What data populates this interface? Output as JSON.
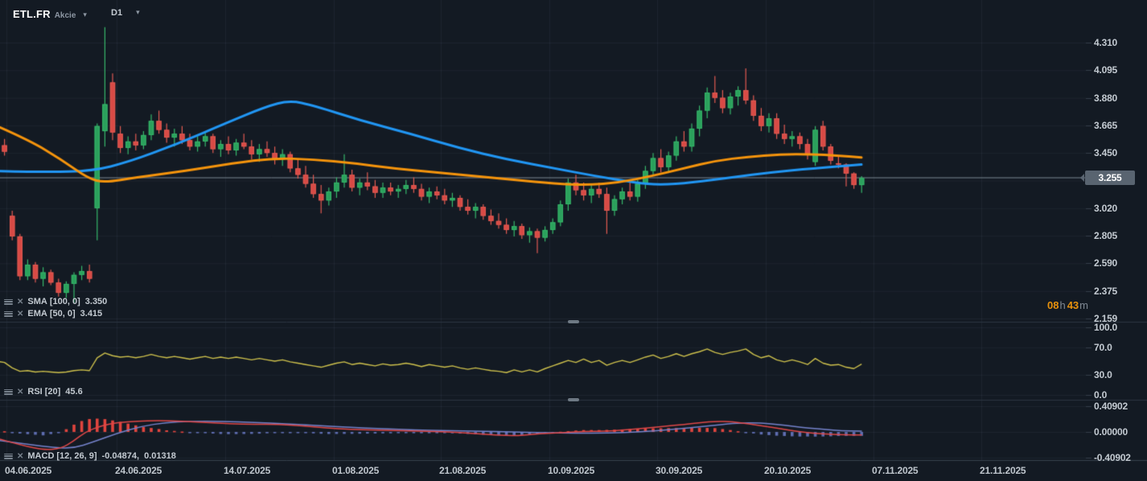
{
  "header": {
    "symbol": "ETL.FR",
    "instrument_type": "Akcie",
    "timeframe": "D1"
  },
  "indicators": {
    "sma": {
      "name": "SMA",
      "params": "[100, 0]",
      "value": "3.350"
    },
    "ema": {
      "name": "EMA",
      "params": "[50, 0]",
      "value": "3.415"
    },
    "rsi": {
      "name": "RSI",
      "params": "[20]",
      "value": "45.6"
    },
    "macd": {
      "name": "MACD",
      "params": "[12, 26, 9]",
      "value": "-0.04874,  0.01318"
    }
  },
  "countdown": {
    "hours": "08",
    "hours_unit": "h",
    "minutes": "43",
    "minutes_unit": "m"
  },
  "price_axis": {
    "current_price": "3.255",
    "labels": [
      "4.310",
      "4.095",
      "3.880",
      "3.665",
      "3.450",
      "3.020",
      "2.805",
      "2.590",
      "2.375",
      "2.159"
    ]
  },
  "rsi_axis_labels": [
    "100.0",
    "70.0",
    "30.0",
    "0.0"
  ],
  "macd_axis_labels": [
    "0.40902",
    "0.00000",
    "-0.40902"
  ],
  "time_axis_labels": [
    "04.06.2025",
    "24.06.2025",
    "14.07.2025",
    "01.08.2025",
    "21.08.2025",
    "10.09.2025",
    "30.09.2025",
    "20.10.2025",
    "07.11.2025",
    "21.11.2025"
  ],
  "colors": {
    "bg": "#131a23",
    "grid": "rgba(156,172,190,0.08)",
    "separator": "#2b3542",
    "time_border": "#38424e",
    "candle_up": "#2ba05c",
    "candle_up_edge": "#36b76a",
    "candle_down": "#d84a45",
    "candle_down_edge": "#e25a52",
    "sma_line": "#2196f3",
    "ema_line": "#f5940c",
    "rsi_line": "#cdc04c",
    "macd_line": "#e04848",
    "signal_line": "#7583cc",
    "hist_positive": "#e0443d",
    "hist_negative": "#5e6db0",
    "price_line": "#7c8793",
    "badge_bg": "#596470",
    "axis_text": "#c3cad1",
    "countdown_digits": "#e8920c",
    "countdown_units": "#7f8893"
  },
  "chart_data": {
    "type": "candlestick",
    "title": "ETL.FR D1 candlesticks with SMA(100), EMA(50), RSI(20) and MACD(12,26,9)",
    "price_axis_range": [
      2.159,
      4.31
    ],
    "price_tick_step": 0.215,
    "rsi_range": [
      0,
      100
    ],
    "macd_range": [
      -0.40902,
      0.40902
    ],
    "legend_position": "top-left-of-each-panel",
    "grid": true,
    "candles_ohlc": [
      [
        3.55,
        3.58,
        3.44,
        3.47
      ],
      [
        3.51,
        3.56,
        3.43,
        3.46
      ],
      [
        2.96,
        3.0,
        2.77,
        2.8
      ],
      [
        2.8,
        2.82,
        2.46,
        2.49
      ],
      [
        2.49,
        2.62,
        2.46,
        2.58
      ],
      [
        2.58,
        2.6,
        2.44,
        2.47
      ],
      [
        2.47,
        2.56,
        2.41,
        2.52
      ],
      [
        2.52,
        2.54,
        2.42,
        2.44
      ],
      [
        2.44,
        2.47,
        2.33,
        2.36
      ],
      [
        2.36,
        2.45,
        2.32,
        2.43
      ],
      [
        2.43,
        2.52,
        2.28,
        2.5
      ],
      [
        2.5,
        2.57,
        2.46,
        2.53
      ],
      [
        2.53,
        2.58,
        2.44,
        2.47
      ],
      [
        3.02,
        3.68,
        2.77,
        3.66
      ],
      [
        3.62,
        4.43,
        3.5,
        3.83
      ],
      [
        4.0,
        4.07,
        3.55,
        3.61
      ],
      [
        3.6,
        3.66,
        3.45,
        3.49
      ],
      [
        3.49,
        3.58,
        3.44,
        3.54
      ],
      [
        3.54,
        3.6,
        3.47,
        3.51
      ],
      [
        3.51,
        3.62,
        3.48,
        3.59
      ],
      [
        3.59,
        3.75,
        3.55,
        3.7
      ],
      [
        3.7,
        3.78,
        3.6,
        3.63
      ],
      [
        3.63,
        3.68,
        3.53,
        3.57
      ],
      [
        3.57,
        3.64,
        3.5,
        3.6
      ],
      [
        3.6,
        3.66,
        3.52,
        3.55
      ],
      [
        3.55,
        3.6,
        3.47,
        3.5
      ],
      [
        3.5,
        3.58,
        3.46,
        3.54
      ],
      [
        3.54,
        3.62,
        3.5,
        3.58
      ],
      [
        3.58,
        3.6,
        3.45,
        3.48
      ],
      [
        3.48,
        3.55,
        3.42,
        3.52
      ],
      [
        3.52,
        3.58,
        3.44,
        3.47
      ],
      [
        3.47,
        3.56,
        3.43,
        3.53
      ],
      [
        3.53,
        3.6,
        3.48,
        3.5
      ],
      [
        3.5,
        3.55,
        3.4,
        3.44
      ],
      [
        3.44,
        3.52,
        3.38,
        3.48
      ],
      [
        3.48,
        3.54,
        3.42,
        3.45
      ],
      [
        3.45,
        3.5,
        3.36,
        3.4
      ],
      [
        3.4,
        3.48,
        3.35,
        3.44
      ],
      [
        3.44,
        3.46,
        3.3,
        3.33
      ],
      [
        3.33,
        3.4,
        3.25,
        3.28
      ],
      [
        3.28,
        3.35,
        3.18,
        3.21
      ],
      [
        3.21,
        3.28,
        3.1,
        3.13
      ],
      [
        3.13,
        3.2,
        2.98,
        3.08
      ],
      [
        3.08,
        3.18,
        3.04,
        3.15
      ],
      [
        3.15,
        3.26,
        3.1,
        3.22
      ],
      [
        3.22,
        3.44,
        3.18,
        3.28
      ],
      [
        3.28,
        3.32,
        3.15,
        3.18
      ],
      [
        3.18,
        3.25,
        3.12,
        3.22
      ],
      [
        3.22,
        3.3,
        3.16,
        3.19
      ],
      [
        3.19,
        3.24,
        3.1,
        3.14
      ],
      [
        3.14,
        3.22,
        3.1,
        3.18
      ],
      [
        3.18,
        3.22,
        3.12,
        3.15
      ],
      [
        3.15,
        3.2,
        3.1,
        3.17
      ],
      [
        3.17,
        3.24,
        3.13,
        3.2
      ],
      [
        3.2,
        3.26,
        3.14,
        3.17
      ],
      [
        3.17,
        3.21,
        3.08,
        3.11
      ],
      [
        3.11,
        3.18,
        3.06,
        3.15
      ],
      [
        3.15,
        3.19,
        3.09,
        3.12
      ],
      [
        3.12,
        3.17,
        3.05,
        3.08
      ],
      [
        3.08,
        3.14,
        3.03,
        3.1
      ],
      [
        3.1,
        3.12,
        3.0,
        3.03
      ],
      [
        3.03,
        3.09,
        2.97,
        3.0
      ],
      [
        3.0,
        3.06,
        2.94,
        3.03
      ],
      [
        3.03,
        3.05,
        2.93,
        2.96
      ],
      [
        2.96,
        3.01,
        2.89,
        2.92
      ],
      [
        2.92,
        2.98,
        2.86,
        2.89
      ],
      [
        2.89,
        2.94,
        2.82,
        2.85
      ],
      [
        2.85,
        2.92,
        2.8,
        2.88
      ],
      [
        2.88,
        2.9,
        2.78,
        2.81
      ],
      [
        2.81,
        2.87,
        2.75,
        2.84
      ],
      [
        2.84,
        2.86,
        2.67,
        2.79
      ],
      [
        2.79,
        2.88,
        2.76,
        2.85
      ],
      [
        2.85,
        2.94,
        2.82,
        2.91
      ],
      [
        2.91,
        3.08,
        2.88,
        3.05
      ],
      [
        3.05,
        3.25,
        3.0,
        3.22
      ],
      [
        3.22,
        3.28,
        3.12,
        3.16
      ],
      [
        3.16,
        3.22,
        3.08,
        3.12
      ],
      [
        3.12,
        3.2,
        3.06,
        3.17
      ],
      [
        3.17,
        3.22,
        3.1,
        3.13
      ],
      [
        3.13,
        3.18,
        2.82,
        3.0
      ],
      [
        3.0,
        3.12,
        2.96,
        3.09
      ],
      [
        3.09,
        3.18,
        3.05,
        3.15
      ],
      [
        3.15,
        3.22,
        3.08,
        3.11
      ],
      [
        3.11,
        3.24,
        3.07,
        3.21
      ],
      [
        3.21,
        3.35,
        3.17,
        3.31
      ],
      [
        3.31,
        3.45,
        3.27,
        3.41
      ],
      [
        3.41,
        3.48,
        3.3,
        3.34
      ],
      [
        3.34,
        3.46,
        3.3,
        3.43
      ],
      [
        3.43,
        3.58,
        3.39,
        3.54
      ],
      [
        3.54,
        3.62,
        3.46,
        3.5
      ],
      [
        3.5,
        3.68,
        3.46,
        3.64
      ],
      [
        3.64,
        3.82,
        3.58,
        3.78
      ],
      [
        3.78,
        3.96,
        3.72,
        3.92
      ],
      [
        3.92,
        4.05,
        3.84,
        3.88
      ],
      [
        3.88,
        3.94,
        3.76,
        3.8
      ],
      [
        3.8,
        3.92,
        3.75,
        3.89
      ],
      [
        3.89,
        3.97,
        3.82,
        3.94
      ],
      [
        3.94,
        4.11,
        3.83,
        3.86
      ],
      [
        3.86,
        3.9,
        3.7,
        3.74
      ],
      [
        3.74,
        3.8,
        3.62,
        3.66
      ],
      [
        3.66,
        3.76,
        3.61,
        3.72
      ],
      [
        3.72,
        3.76,
        3.56,
        3.6
      ],
      [
        3.6,
        3.67,
        3.52,
        3.56
      ],
      [
        3.56,
        3.62,
        3.5,
        3.58
      ],
      [
        3.58,
        3.61,
        3.48,
        3.52
      ],
      [
        3.52,
        3.56,
        3.4,
        3.44
      ],
      [
        3.38,
        3.66,
        3.35,
        3.63
      ],
      [
        3.66,
        3.7,
        3.47,
        3.5
      ],
      [
        3.5,
        3.52,
        3.36,
        3.39
      ],
      [
        3.37,
        3.42,
        3.33,
        3.36
      ],
      [
        3.36,
        3.37,
        3.19,
        3.29
      ],
      [
        3.29,
        3.3,
        3.17,
        3.2
      ],
      [
        3.2,
        3.27,
        3.14,
        3.255
      ]
    ],
    "overlays": {
      "sma_100_points": [
        [
          -4,
          3.31
        ],
        [
          56,
          3.3
        ],
        [
          115,
          3.31
        ],
        [
          160,
          3.38
        ],
        [
          220,
          3.52
        ],
        [
          280,
          3.68
        ],
        [
          330,
          3.81
        ],
        [
          360,
          3.86
        ],
        [
          390,
          3.82
        ],
        [
          450,
          3.7
        ],
        [
          510,
          3.6
        ],
        [
          570,
          3.49
        ],
        [
          630,
          3.4
        ],
        [
          690,
          3.33
        ],
        [
          740,
          3.27
        ],
        [
          790,
          3.22
        ],
        [
          820,
          3.2
        ],
        [
          860,
          3.22
        ],
        [
          910,
          3.26
        ],
        [
          960,
          3.3
        ],
        [
          1010,
          3.33
        ],
        [
          1071,
          3.36
        ]
      ],
      "ema_50_points": [
        [
          -4,
          3.66
        ],
        [
          36,
          3.55
        ],
        [
          76,
          3.4
        ],
        [
          110,
          3.25
        ],
        [
          130,
          3.22
        ],
        [
          170,
          3.26
        ],
        [
          230,
          3.31
        ],
        [
          290,
          3.37
        ],
        [
          340,
          3.41
        ],
        [
          390,
          3.4
        ],
        [
          440,
          3.37
        ],
        [
          490,
          3.33
        ],
        [
          540,
          3.3
        ],
        [
          590,
          3.27
        ],
        [
          640,
          3.24
        ],
        [
          690,
          3.21
        ],
        [
          730,
          3.2
        ],
        [
          770,
          3.22
        ],
        [
          810,
          3.27
        ],
        [
          850,
          3.33
        ],
        [
          890,
          3.39
        ],
        [
          930,
          3.42
        ],
        [
          970,
          3.44
        ],
        [
          1010,
          3.44
        ],
        [
          1040,
          3.43
        ],
        [
          1071,
          3.415
        ]
      ]
    },
    "rsi_20_values": [
      50,
      48,
      40,
      35,
      36,
      34,
      35,
      34,
      33,
      34,
      36,
      37,
      36,
      55,
      62,
      58,
      56,
      57,
      55,
      57,
      60,
      57,
      55,
      57,
      55,
      53,
      55,
      57,
      54,
      56,
      54,
      56,
      54,
      52,
      54,
      52,
      50,
      52,
      49,
      47,
      45,
      43,
      41,
      44,
      47,
      49,
      45,
      47,
      45,
      43,
      46,
      44,
      45,
      47,
      45,
      42,
      45,
      43,
      41,
      43,
      40,
      38,
      40,
      38,
      36,
      35,
      33,
      37,
      34,
      37,
      34,
      39,
      43,
      47,
      51,
      48,
      53,
      48,
      51,
      44,
      48,
      51,
      48,
      52,
      56,
      59,
      54,
      57,
      61,
      57,
      61,
      64,
      68,
      63,
      60,
      63,
      65,
      68,
      60,
      55,
      58,
      52,
      49,
      52,
      49,
      45,
      54,
      47,
      44,
      45,
      41,
      39,
      45.6
    ],
    "macd": {
      "macd_line_points": [
        [
          -4,
          -0.1
        ],
        [
          26,
          -0.21
        ],
        [
          56,
          -0.29
        ],
        [
          76,
          -0.26
        ],
        [
          91,
          -0.15
        ],
        [
          106,
          0.0
        ],
        [
          126,
          0.1
        ],
        [
          146,
          0.15
        ],
        [
          171,
          0.17
        ],
        [
          196,
          0.18
        ],
        [
          226,
          0.17
        ],
        [
          256,
          0.15
        ],
        [
          286,
          0.13
        ],
        [
          316,
          0.12
        ],
        [
          346,
          0.12
        ],
        [
          376,
          0.1
        ],
        [
          406,
          0.06
        ],
        [
          436,
          0.04
        ],
        [
          466,
          0.03
        ],
        [
          496,
          0.02
        ],
        [
          526,
          0.01
        ],
        [
          556,
          0.0
        ],
        [
          586,
          -0.02
        ],
        [
          616,
          -0.05
        ],
        [
          641,
          -0.06
        ],
        [
          661,
          -0.04
        ],
        [
          681,
          -0.02
        ],
        [
          701,
          -0.01
        ],
        [
          726,
          0.01
        ],
        [
          751,
          0.01
        ],
        [
          776,
          0.03
        ],
        [
          801,
          0.06
        ],
        [
          826,
          0.09
        ],
        [
          851,
          0.12
        ],
        [
          871,
          0.15
        ],
        [
          891,
          0.17
        ],
        [
          911,
          0.16
        ],
        [
          931,
          0.13
        ],
        [
          951,
          0.09
        ],
        [
          971,
          0.05
        ],
        [
          991,
          0.01
        ],
        [
          1011,
          -0.02
        ],
        [
          1031,
          -0.035
        ],
        [
          1051,
          -0.045
        ],
        [
          1071,
          -0.0487
        ]
      ],
      "signal_line_points": [
        [
          -4,
          -0.13
        ],
        [
          36,
          -0.2
        ],
        [
          66,
          -0.25
        ],
        [
          91,
          -0.26
        ],
        [
          116,
          -0.16
        ],
        [
          146,
          -0.02
        ],
        [
          176,
          0.09
        ],
        [
          206,
          0.15
        ],
        [
          236,
          0.17
        ],
        [
          276,
          0.17
        ],
        [
          316,
          0.15
        ],
        [
          356,
          0.13
        ],
        [
          396,
          0.1
        ],
        [
          436,
          0.07
        ],
        [
          476,
          0.05
        ],
        [
          516,
          0.03
        ],
        [
          556,
          0.02
        ],
        [
          596,
          0.01
        ],
        [
          636,
          0.0
        ],
        [
          676,
          -0.01
        ],
        [
          716,
          -0.02
        ],
        [
          756,
          -0.02
        ],
        [
          796,
          0.0
        ],
        [
          836,
          0.04
        ],
        [
          876,
          0.09
        ],
        [
          906,
          0.13
        ],
        [
          926,
          0.145
        ],
        [
          946,
          0.14
        ],
        [
          966,
          0.12
        ],
        [
          986,
          0.09
        ],
        [
          1006,
          0.06
        ],
        [
          1026,
          0.04
        ],
        [
          1046,
          0.02
        ],
        [
          1071,
          0.013
        ]
      ]
    }
  }
}
